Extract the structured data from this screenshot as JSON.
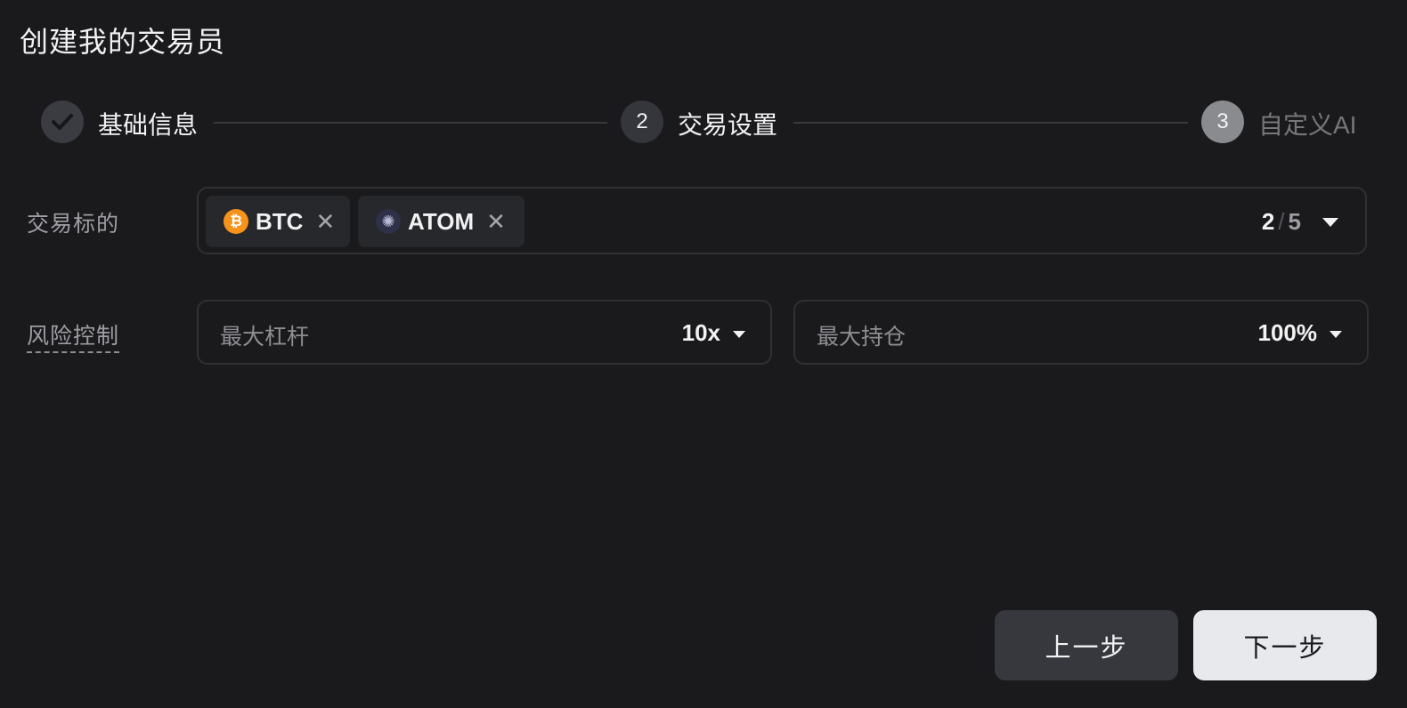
{
  "dialog": {
    "title": "创建我的交易员"
  },
  "steps": [
    {
      "number": "",
      "label": "基础信息",
      "state": "completed",
      "icon": "check-icon"
    },
    {
      "number": "2",
      "label": "交易设置",
      "state": "active"
    },
    {
      "number": "3",
      "label": "自定义AI",
      "state": "pending"
    }
  ],
  "form": {
    "target": {
      "label": "交易标的",
      "tags": [
        {
          "name": "BTC",
          "icon": "bitcoin-icon",
          "icon_glyph": "₿",
          "color": "#f7931a"
        },
        {
          "name": "ATOM",
          "icon": "cosmos-atom-icon",
          "icon_glyph": "✺",
          "color": "#2e3148"
        }
      ],
      "selected_count": "2",
      "separator": "/",
      "max_count": "5"
    },
    "risk": {
      "label": "风险控制",
      "max_leverage": {
        "label": "最大杠杆",
        "value": "10x"
      },
      "max_position": {
        "label": "最大持仓",
        "value": "100%"
      }
    }
  },
  "buttons": {
    "prev": "上一步",
    "next": "下一步"
  },
  "colors": {
    "background": "#1a1a1c",
    "primary_button": "#e8e9ec",
    "secondary_button": "#36383e"
  }
}
